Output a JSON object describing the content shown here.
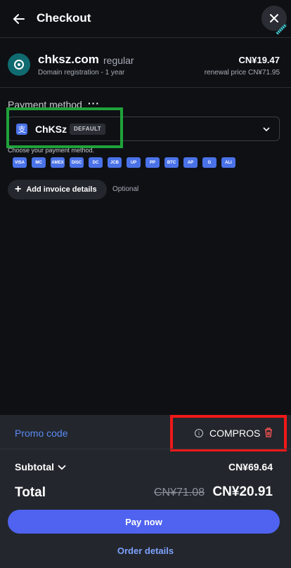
{
  "header": {
    "title": "Checkout"
  },
  "domain": {
    "name": "chksz.com",
    "plan": "regular",
    "subtitle": "Domain registration - 1 year",
    "price": "CN¥19.47",
    "renewal": "renewal price CN¥71.95"
  },
  "payment": {
    "label": "Payment method",
    "selected_name": "ChKSz",
    "badge": "DEFAULT",
    "hint": "Choose your payment method.",
    "icons": [
      "VISA",
      "MC",
      "AMEX",
      "DISC",
      "DC",
      "JCB",
      "UP",
      "PP",
      "BTC",
      "AP",
      "G",
      "ALI"
    ]
  },
  "invoice": {
    "label": "Add invoice details",
    "optional": "Optional"
  },
  "summary": {
    "promo_link": "Promo code",
    "promo_code": "COMPROS",
    "subtotal_label": "Subtotal",
    "subtotal_value": "CN¥69.64",
    "total_label": "Total",
    "total_old": "CN¥71.08",
    "total_new": "CN¥20.91",
    "pay_button": "Pay now",
    "order_details": "Order details"
  },
  "colors": {
    "accent": "#4f63f0",
    "link": "#5b8bf5",
    "highlight_green": "#1fa33a",
    "highlight_red": "#f01818"
  }
}
